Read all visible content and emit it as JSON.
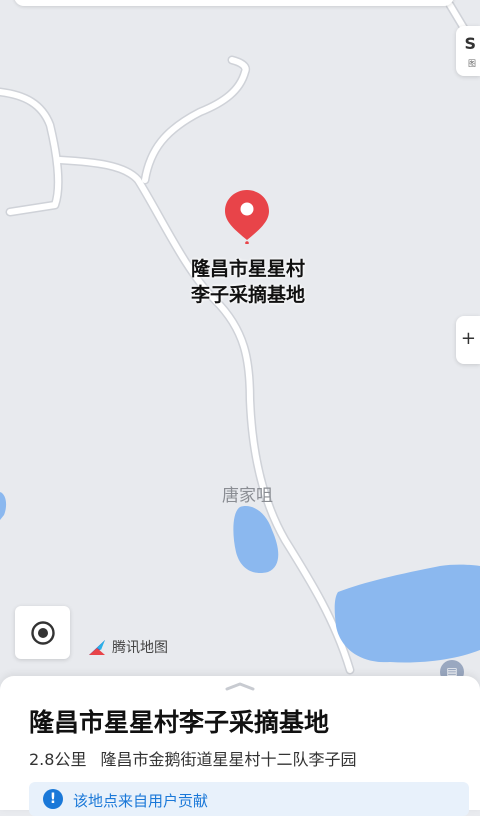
{
  "map": {
    "place_label_line1": "隆昌市星星村",
    "place_label_line2": "李子采摘基地",
    "village_label": "唐家咀",
    "brand_text": "腾讯地图",
    "layer_button_glyph": "S",
    "layer_button_sub": "图",
    "zoom_button_glyph": "+",
    "poi_icon_glyph": "▤",
    "pin_color": "#e84449",
    "water_color": "#8bb8ef",
    "road_color": "#ffffff"
  },
  "sheet": {
    "title": "隆昌市星星村李子采摘基地",
    "distance": "2.8公里",
    "address": "隆昌市金鹅街道星星村十二队李子园",
    "notice_icon": "!",
    "notice_text": "该地点来自用户贡献",
    "accent_color": "#1a78d8"
  }
}
